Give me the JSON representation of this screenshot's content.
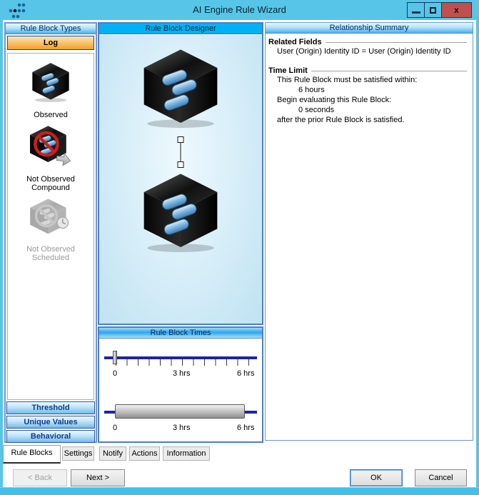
{
  "window": {
    "title": "AI Engine Rule Wizard",
    "close_label": "x"
  },
  "rule_block_types": {
    "header": "Rule Block Types",
    "selected_category": "Log",
    "items": [
      {
        "label": "Observed",
        "icon": "observed-cube-icon",
        "enabled": true
      },
      {
        "label": "Not Observed Compound",
        "icon": "not-observed-compound-icon",
        "enabled": true
      },
      {
        "label": "Not Observed Scheduled",
        "icon": "not-observed-scheduled-icon",
        "enabled": false
      }
    ],
    "category_buttons": [
      {
        "label": "Threshold"
      },
      {
        "label": "Unique Values"
      },
      {
        "label": "Behavioral"
      }
    ]
  },
  "designer": {
    "header": "Rule Block Designer"
  },
  "times": {
    "header": "Rule Block Times",
    "axis_labels": [
      "0",
      "3 hrs",
      "6 hrs"
    ],
    "slider1_value": "0",
    "slider2_range": [
      "0",
      "6 hrs"
    ]
  },
  "summary": {
    "header": "Relationship Summary",
    "related_fields_title": "Related Fields",
    "related_fields_value": "User (Origin) Identity ID = User (Origin) Identity ID",
    "time_limit_title": "Time Limit",
    "time_limit_lines": [
      "This Rule Block must be satisfied within:",
      "6 hours",
      "Begin evaluating this Rule Block:",
      "0 seconds",
      "after the prior Rule Block is satisfied."
    ]
  },
  "tabs": [
    {
      "label": "Rule Blocks",
      "active": true
    },
    {
      "label": "Settings",
      "active": false
    },
    {
      "label": "Notify",
      "active": false
    },
    {
      "label": "Actions",
      "active": false
    },
    {
      "label": "Information",
      "active": false
    }
  ],
  "footer": {
    "back_label": "< Back",
    "next_label": "Next >",
    "ok_label": "OK",
    "cancel_label": "Cancel"
  },
  "colors": {
    "titlebar": "#57c5e8",
    "bottom_strip": "#3ec2ec",
    "close_button": "#c0504d",
    "header_gradient_bottom": "#46b2ee",
    "designer_header": "#00b2f2",
    "log_button_orange": "#f29e2e",
    "category_button_blue": "#6fbcec",
    "slider_track_navy": "#20249c",
    "pill_blue": "#7ab4e0"
  }
}
